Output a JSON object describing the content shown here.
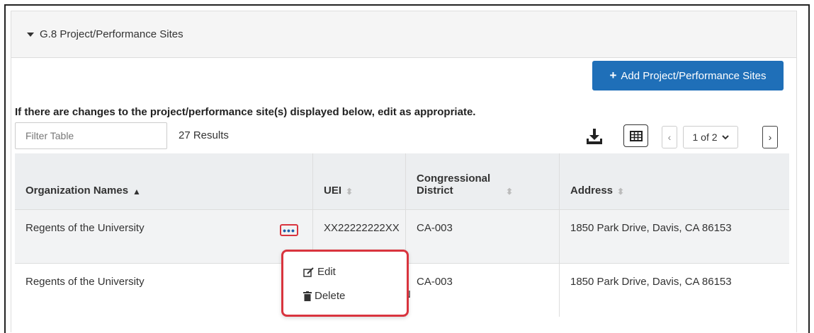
{
  "section": {
    "title": "G.8 Project/Performance Sites"
  },
  "add_button": {
    "label": "Add Project/Performance Sites"
  },
  "notice": "If there are changes to the project/performance site(s) displayed below, edit as appropriate.",
  "filter": {
    "placeholder": "Filter Table"
  },
  "results_count": "27 Results",
  "pagination": {
    "current": "1 of 2"
  },
  "table": {
    "headers": [
      "Organization Names",
      "UEI",
      "Congressional District",
      "Address"
    ],
    "rows": [
      {
        "org": "Regents of the University",
        "uei": "XX22222222XX",
        "district": "CA-003",
        "address": "1850 Park Drive, Davis, CA 86153"
      },
      {
        "org": "Regents of the University",
        "uei_fragment_1": "N",
        "uei_fragment_2": "Z3",
        "district": "CA-003",
        "address": "1850 Park Drive,  Davis, CA 86153"
      }
    ]
  },
  "row_menu": {
    "edit": "Edit",
    "delete": "Delete"
  },
  "colors": {
    "primary": "#1f6fb8",
    "highlight": "#d9343e"
  }
}
